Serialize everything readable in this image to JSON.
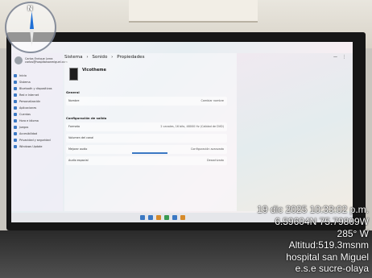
{
  "settings": {
    "user_name": "Carlos Enrique Lerra",
    "user_sub": "carlos@hospitalsanmiguel.com",
    "breadcrumb": [
      "Sistema",
      "›",
      "Sonido",
      "›",
      "Propiedades"
    ],
    "device_name": "Vicotheme",
    "nav_items": [
      "Inicio",
      "Sistema",
      "Bluetooth y dispositivos",
      "Red e Internet",
      "Personalización",
      "Aplicaciones",
      "Cuentas",
      "Hora e idioma",
      "Juegos",
      "Accesibilidad",
      "Privacidad y seguridad",
      "Windows Update"
    ],
    "sections": [
      "General",
      "Configuración de salida"
    ],
    "rows": [
      {
        "label": "Nombre",
        "value": "Cambiar nombre"
      },
      {
        "label": "Formato",
        "value": "2 canales, 16 bits, 48000 Hz (Calidad de DVD)"
      },
      {
        "label": "Volumen del canal",
        "value": ""
      },
      {
        "label": "Mejorar audio",
        "value": "Configuración avanzada"
      },
      {
        "label": "Audio espacial",
        "value": "Desactivado"
      }
    ]
  },
  "overlay": {
    "line1": "19 dic 2025 10:33:02 p.m.",
    "line2": "6.59604N 75.79809W",
    "line3": "285° W",
    "line4": "Altitud:519.3msnm",
    "line5": "hospital san Miguel",
    "line6": "e.s.e sucre-olaya"
  },
  "compass_label": "N"
}
